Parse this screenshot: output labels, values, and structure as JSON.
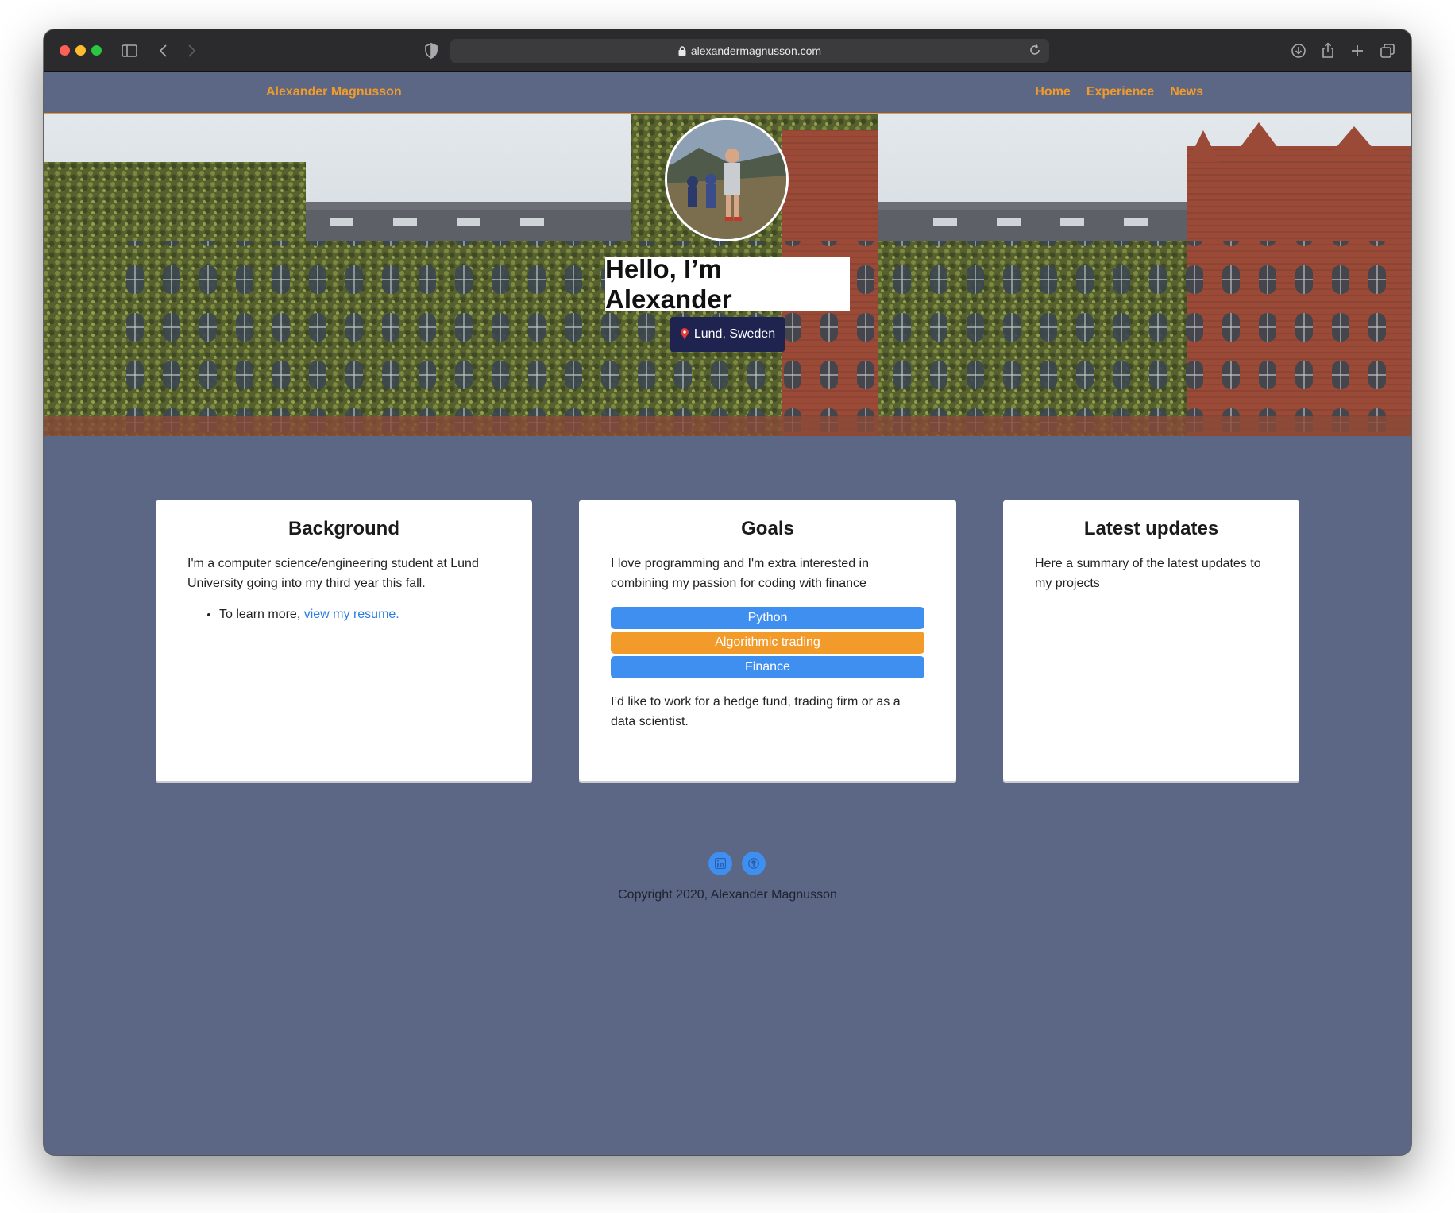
{
  "browser": {
    "url": "alexandermagnusson.com"
  },
  "nav": {
    "brand": "Alexander Magnusson",
    "links": [
      "Home",
      "Experience",
      "News"
    ]
  },
  "hero": {
    "title": "Hello, I’m Alexander",
    "location": "Lund, Sweden"
  },
  "cards": {
    "background": {
      "title": "Background",
      "text": "I'm a computer science/engineering student at Lund University going into my third year this fall.",
      "bullet_prefix": "To learn more, ",
      "bullet_link": "view my resume."
    },
    "goals": {
      "title": "Goals",
      "text": "I love programming and I'm extra interested in combining my passion for coding with finance",
      "tags": [
        {
          "label": "Python",
          "color": "#3e8ff0"
        },
        {
          "label": "Algorithmic trading",
          "color": "#f29b2a"
        },
        {
          "label": "Finance",
          "color": "#3e8ff0"
        }
      ],
      "text2": "I’d like to work for a hedge fund, trading firm or as a data scientist."
    },
    "latest": {
      "title": "Latest updates",
      "text": "Here a summary of the latest updates to my projects"
    }
  },
  "footer": {
    "socials": [
      "linkedin-icon",
      "github-icon"
    ],
    "copyright": "Copyright 2020, Alexander Magnusson"
  },
  "colors": {
    "page_bg": "#5b6785",
    "accent": "#f29b2a",
    "location_badge": "#1f2350",
    "link": "#2a7de1"
  }
}
